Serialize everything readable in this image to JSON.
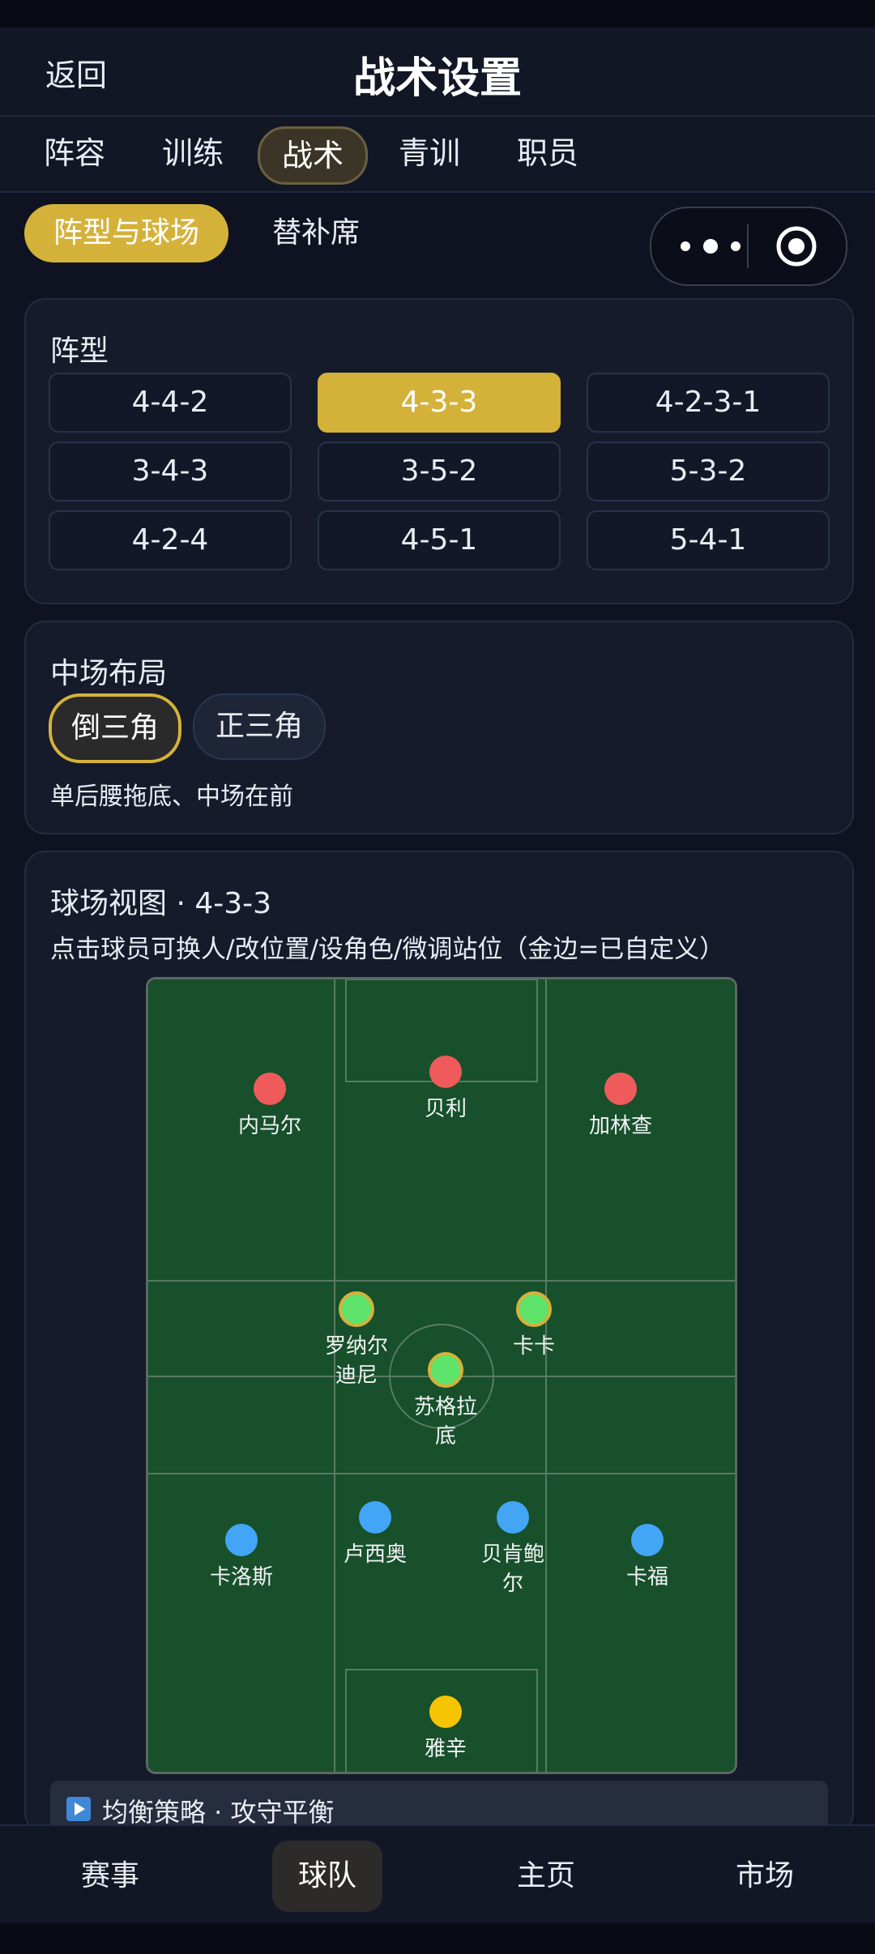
{
  "header": {
    "back_label": "返回",
    "title": "战术设置"
  },
  "tabs": [
    {
      "label": "阵容",
      "active": false
    },
    {
      "label": "训练",
      "active": false
    },
    {
      "label": "战术",
      "active": true
    },
    {
      "label": "青训",
      "active": false
    },
    {
      "label": "职员",
      "active": false
    }
  ],
  "segments": [
    {
      "label": "阵型与球场",
      "active": true
    },
    {
      "label": "替补席",
      "active": false
    }
  ],
  "capsule": {
    "more_icon": "more-dots-icon",
    "close_icon": "target-icon"
  },
  "formation": {
    "title": "阵型",
    "options": [
      "4-4-2",
      "4-3-3",
      "4-2-3-1",
      "3-4-3",
      "3-5-2",
      "5-3-2",
      "4-2-4",
      "4-5-1",
      "5-4-1"
    ],
    "selected": "4-3-3"
  },
  "midfield": {
    "title": "中场布局",
    "options": [
      {
        "label": "倒三角",
        "active": true
      },
      {
        "label": "正三角",
        "active": false
      }
    ],
    "description": "单后腰拖底、中场在前"
  },
  "pitch": {
    "title": "球场视图 · 4-3-3",
    "subtitle": "点击球员可换人/改位置/设角色/微调站位（金边=已自定义）",
    "players": [
      {
        "name": "内马尔",
        "role": "forward",
        "custom": false
      },
      {
        "name": "贝利",
        "role": "forward",
        "custom": false
      },
      {
        "name": "加林查",
        "role": "forward",
        "custom": false
      },
      {
        "name": "罗纳尔迪尼",
        "role": "midfield",
        "custom": true
      },
      {
        "name": "卡卡",
        "role": "midfield",
        "custom": true
      },
      {
        "name": "苏格拉底",
        "role": "midfield",
        "custom": true
      },
      {
        "name": "卡洛斯",
        "role": "defender",
        "custom": false
      },
      {
        "name": "卢西奥",
        "role": "defender",
        "custom": false
      },
      {
        "name": "贝肯鲍尔",
        "role": "defender",
        "custom": false
      },
      {
        "name": "卡福",
        "role": "defender",
        "custom": false
      },
      {
        "name": "雅辛",
        "role": "goalkeeper",
        "custom": false
      }
    ],
    "colors": {
      "forward": "#ef5b5b",
      "midfield": "#5ee36b",
      "defender": "#42a5f5",
      "goalkeeper": "#f7c400",
      "custom_ring": "#d4b23a",
      "grass": "#17502b",
      "line": "#6c8a73"
    }
  },
  "strategy": {
    "label": "均衡策略 · 攻守平衡",
    "icon": "play-icon"
  },
  "bottom_nav": [
    {
      "label": "赛事",
      "active": false
    },
    {
      "label": "球队",
      "active": true
    },
    {
      "label": "主页",
      "active": false
    },
    {
      "label": "市场",
      "active": false
    }
  ]
}
